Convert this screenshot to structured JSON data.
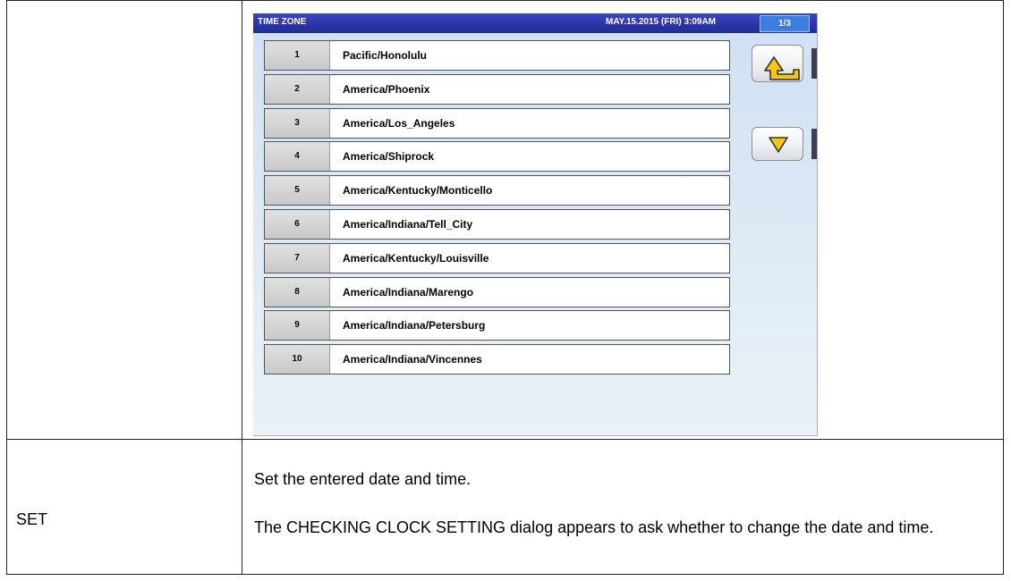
{
  "screen": {
    "title": "TIME ZONE",
    "datetime": "MAY.15.2015 (FRI)  3:09AM",
    "page": "1/3",
    "rows": [
      {
        "num": "1",
        "name": "Pacific/Honolulu"
      },
      {
        "num": "2",
        "name": "America/Phoenix"
      },
      {
        "num": "3",
        "name": "America/Los_Angeles"
      },
      {
        "num": "4",
        "name": "America/Shiprock"
      },
      {
        "num": "5",
        "name": "America/Kentucky/Monticello"
      },
      {
        "num": "6",
        "name": "America/Indiana/Tell_City"
      },
      {
        "num": "7",
        "name": "America/Kentucky/Louisville"
      },
      {
        "num": "8",
        "name": "America/Indiana/Marengo"
      },
      {
        "num": "9",
        "name": "America/Indiana/Petersburg"
      },
      {
        "num": "10",
        "name": "America/Indiana/Vincennes"
      }
    ],
    "buttons": {
      "back_icon": "return-arrow-icon",
      "next_icon": "down-triangle-icon"
    },
    "colors": {
      "titlebar": "#2a33a6",
      "page_indicator": "#3b7de0",
      "icon_fill": "#f5c518"
    }
  },
  "doc": {
    "label": "SET",
    "desc_line1": "Set the entered date and time.",
    "desc_line2": "The CHECKING CLOCK SETTING dialog appears to ask whether to change the date and time."
  }
}
